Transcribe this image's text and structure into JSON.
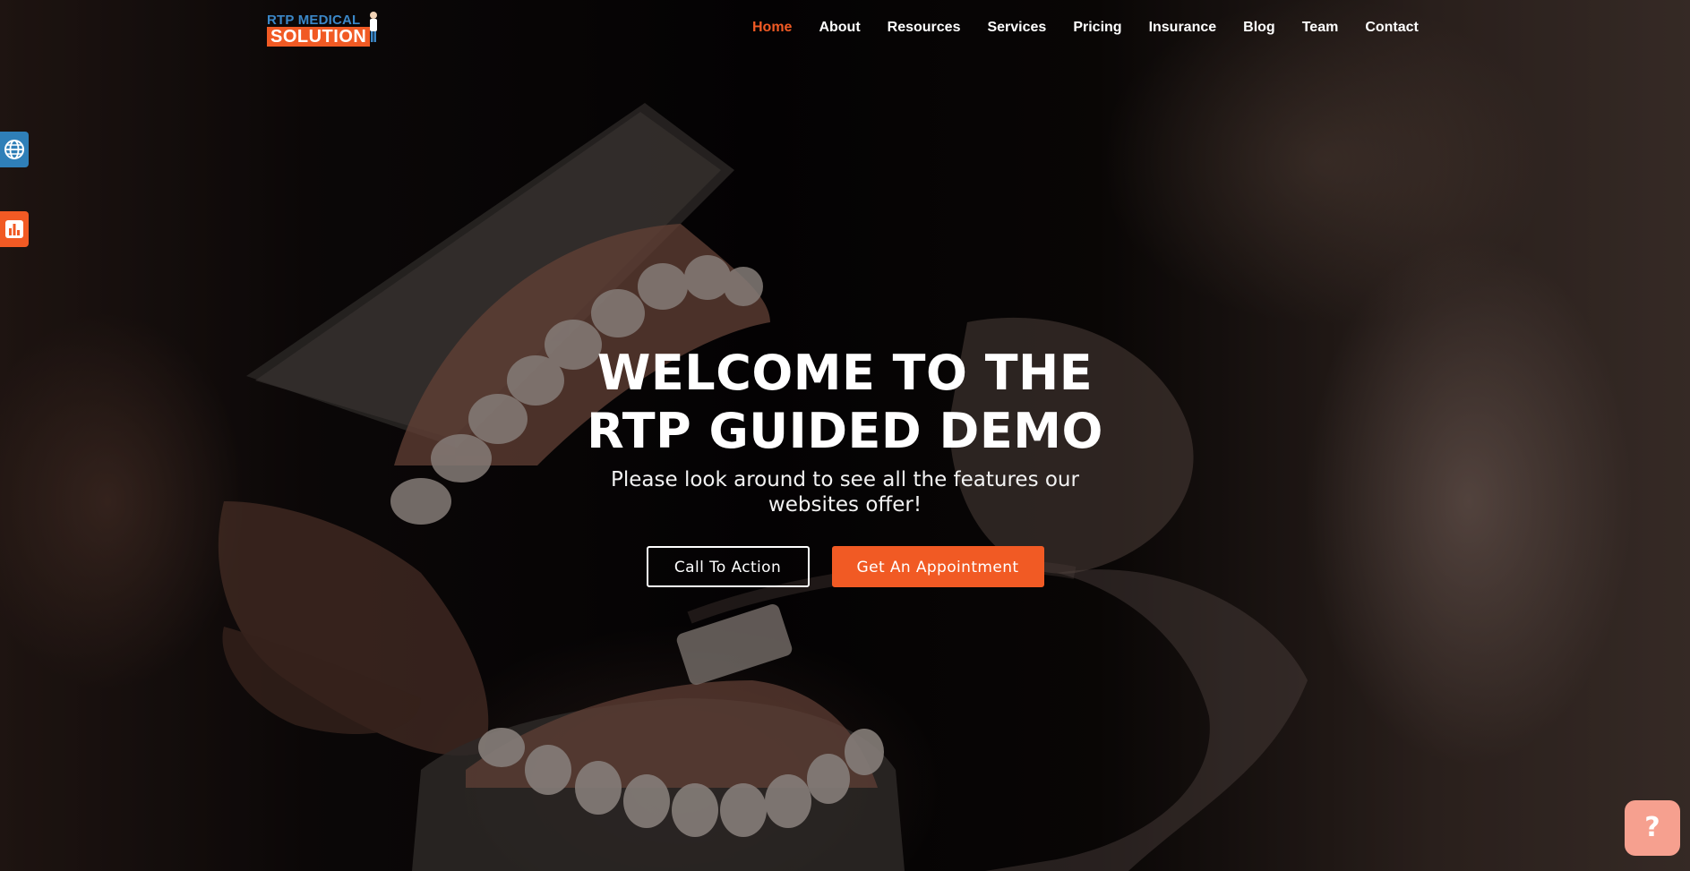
{
  "brand": {
    "logo_top": "RTP MEDICAL",
    "logo_bottom": "SOLUTION",
    "accent_color": "#f15a24",
    "logo_blue": "#3b87c7"
  },
  "nav": {
    "items": [
      {
        "label": "Home",
        "active": true
      },
      {
        "label": "About",
        "active": false
      },
      {
        "label": "Resources",
        "active": false
      },
      {
        "label": "Services",
        "active": false
      },
      {
        "label": "Pricing",
        "active": false
      },
      {
        "label": "Insurance",
        "active": false
      },
      {
        "label": "Blog",
        "active": false
      },
      {
        "label": "Team",
        "active": false
      },
      {
        "label": "Contact",
        "active": false
      }
    ]
  },
  "side_widgets": {
    "globe_icon": "globe-icon",
    "stats_icon": "bar-chart-icon"
  },
  "hero": {
    "title_line1": "WELCOME TO THE",
    "title_line2": "RTP GUIDED DEMO",
    "subtitle": "Please look around to see all the features our websites offer!",
    "cta_secondary": "Call To Action",
    "cta_primary": "Get An Appointment"
  },
  "help": {
    "label": "?",
    "icon": "question-icon",
    "color": "#f6a08f"
  }
}
